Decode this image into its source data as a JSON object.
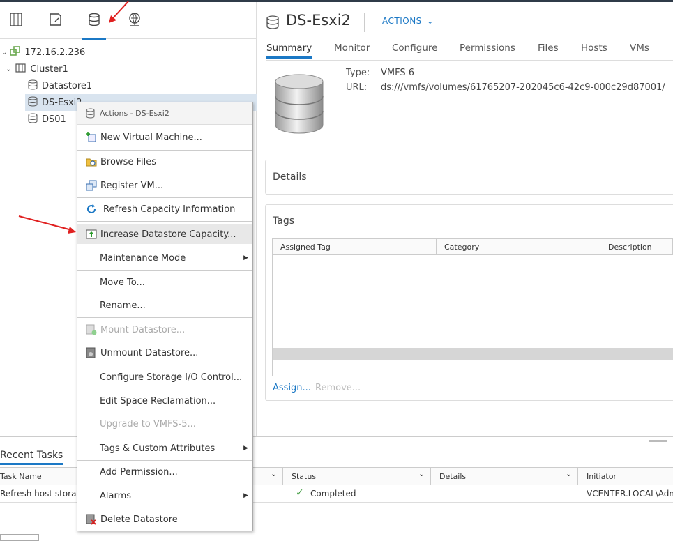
{
  "navigator": {
    "tree": [
      {
        "label": "172.16.2.236",
        "icon": "vcenter-icon"
      },
      {
        "label": "Cluster1",
        "icon": "cluster-icon"
      },
      {
        "label": "Datastore1",
        "icon": "datastore-icon"
      },
      {
        "label": "DS-Esxi2",
        "icon": "datastore-icon"
      },
      {
        "label": "DS01",
        "icon": "datastore-icon"
      }
    ]
  },
  "main": {
    "title": "DS-Esxi2",
    "actions_label": "ACTIONS",
    "tabs": [
      "Summary",
      "Monitor",
      "Configure",
      "Permissions",
      "Files",
      "Hosts",
      "VMs"
    ],
    "type_key": "Type:",
    "type_value": "VMFS 6",
    "url_key": "URL:",
    "url_value": "ds:///vmfs/volumes/61765207-202045c6-42c9-000c29d87001/",
    "details_title": "Details",
    "tags_title": "Tags",
    "tags_columns": [
      "Assigned Tag",
      "Category",
      "Description"
    ],
    "assign_label": "Assign...",
    "remove_label": "Remove..."
  },
  "context_menu": {
    "header": "Actions - DS-Esxi2",
    "items": [
      {
        "label": "New Virtual Machine...",
        "icon": "new-vm-icon"
      },
      {
        "label": "Browse Files",
        "icon": "browse-files-icon"
      },
      {
        "label": "Register VM...",
        "icon": "register-vm-icon"
      },
      {
        "label": "Refresh Capacity Information",
        "icon": "refresh-icon"
      },
      {
        "label": "Increase Datastore Capacity...",
        "icon": "increase-capacity-icon"
      },
      {
        "label": "Maintenance Mode"
      },
      {
        "label": "Move To..."
      },
      {
        "label": "Rename..."
      },
      {
        "label": "Mount Datastore...",
        "icon": "mount-datastore-icon"
      },
      {
        "label": "Unmount Datastore...",
        "icon": "unmount-datastore-icon"
      },
      {
        "label": "Configure Storage I/O Control..."
      },
      {
        "label": "Edit Space Reclamation..."
      },
      {
        "label": "Upgrade to VMFS-5..."
      },
      {
        "label": "Tags & Custom Attributes"
      },
      {
        "label": "Add Permission..."
      },
      {
        "label": "Alarms"
      },
      {
        "label": "Delete Datastore",
        "icon": "delete-datastore-icon"
      }
    ]
  },
  "recent_tasks": {
    "title": "Recent Tasks",
    "columns": [
      "Task Name",
      "Status",
      "Details",
      "Initiator"
    ],
    "rows": [
      {
        "task": "Refresh host storage",
        "status": "Completed",
        "details": "",
        "initiator": "VCENTER.LOCAL\\Adm"
      }
    ]
  },
  "colors": {
    "accent": "#1b78c5",
    "annotation_arrow": "#e02020",
    "status_ok": "#3c9a3c"
  }
}
